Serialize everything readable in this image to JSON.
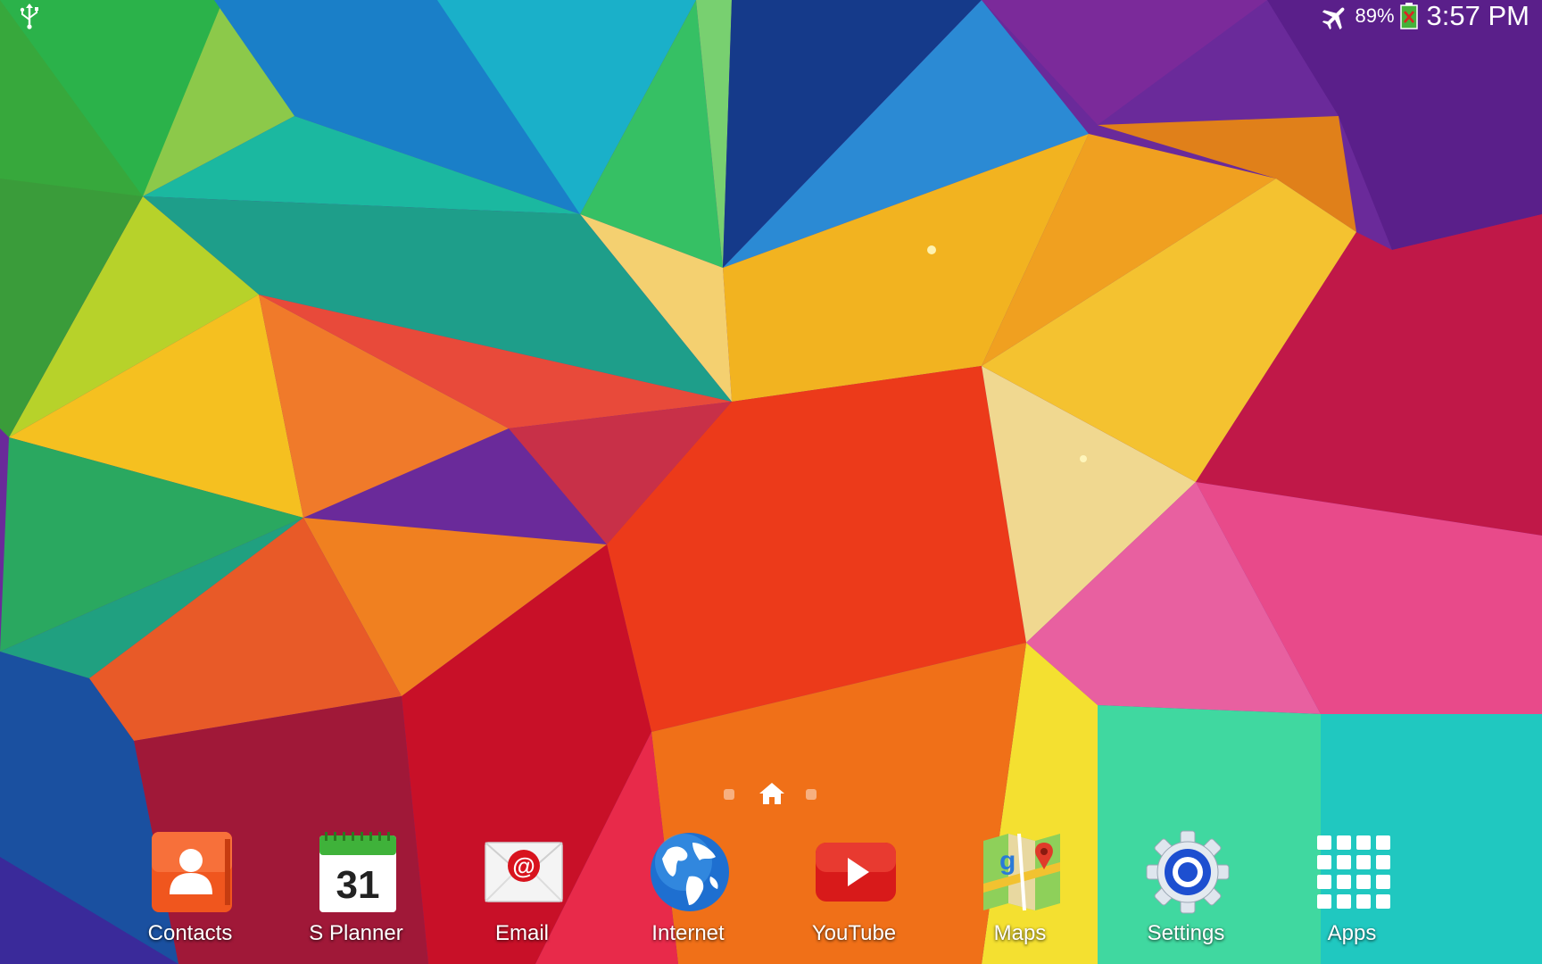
{
  "status_bar": {
    "battery_percent": "89%",
    "time": "3:57 PM",
    "icons": [
      "usb-icon",
      "airplane-mode-icon",
      "battery-icon"
    ]
  },
  "home": {
    "pages": 3,
    "current_page": 2
  },
  "dock": {
    "apps": [
      {
        "label": "Contacts",
        "icon": "contacts-icon"
      },
      {
        "label": "S Planner",
        "icon": "calendar-icon",
        "icon_text": "31"
      },
      {
        "label": "Email",
        "icon": "email-icon"
      },
      {
        "label": "Internet",
        "icon": "globe-icon"
      },
      {
        "label": "YouTube",
        "icon": "youtube-icon"
      },
      {
        "label": "Maps",
        "icon": "maps-icon"
      },
      {
        "label": "Settings",
        "icon": "gear-icon"
      },
      {
        "label": "Apps",
        "icon": "apps-grid-icon"
      }
    ]
  }
}
